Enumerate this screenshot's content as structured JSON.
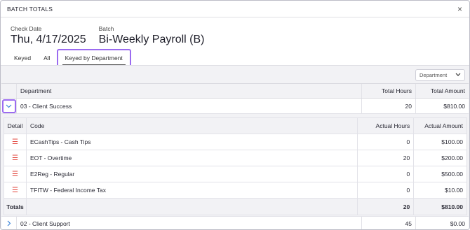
{
  "dialog": {
    "title": "BATCH TOTALS",
    "close_glyph": "×"
  },
  "header": {
    "check_date_label": "Check Date",
    "check_date_value": "Thu, 4/17/2025",
    "batch_label": "Batch",
    "batch_value": "Bi-Weekly Payroll (B)"
  },
  "tabs": [
    {
      "label": "Keyed"
    },
    {
      "label": "All"
    },
    {
      "label": "Keyed by Department",
      "active": true
    }
  ],
  "group_by": {
    "selected": "Department"
  },
  "main_table": {
    "columns": [
      "Department",
      "Total Hours",
      "Total Amount"
    ],
    "rows": [
      {
        "department": "03 - Client Success",
        "hours": "20",
        "amount": "$810.00",
        "expanded": true
      },
      {
        "department": "02 - Client Support",
        "hours": "45",
        "amount": "$0.00",
        "expanded": false
      }
    ]
  },
  "detail_table": {
    "columns": [
      "Detail",
      "Code",
      "Actual Hours",
      "Actual Amount"
    ],
    "rows": [
      {
        "code": "ECashTips - Cash Tips",
        "hours": "0",
        "amount": "$100.00"
      },
      {
        "code": "EOT - Overtime",
        "hours": "20",
        "amount": "$200.00"
      },
      {
        "code": "E2Reg - Regular",
        "hours": "0",
        "amount": "$500.00"
      },
      {
        "code": "TFITW - Federal Income Tax",
        "hours": "0",
        "amount": "$10.00"
      }
    ],
    "totals": {
      "label": "Totals",
      "hours": "20",
      "amount": "$810.00"
    }
  },
  "icons": {
    "expanded": "chevron-down-icon",
    "collapsed": "chevron-right-icon",
    "detail": "list-icon",
    "close": "close-icon"
  },
  "colors": {
    "accent": "#9b6bf0",
    "link": "#2f7dd7",
    "detail_icon": "#e2443c"
  }
}
